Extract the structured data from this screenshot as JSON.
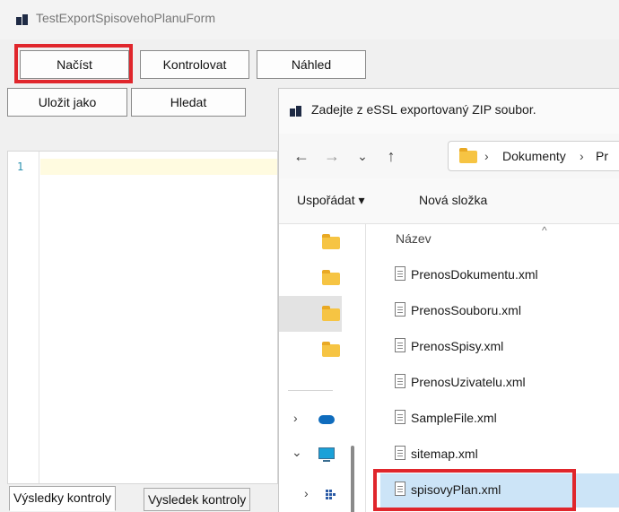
{
  "app": {
    "title": "TestExportSpisovehoPlanuForm"
  },
  "toolbar": {
    "load_label": "Načíst",
    "check_label": "Kontrolovat",
    "preview_label": "Náhled",
    "save_as_label": "Uložit jako",
    "search_label": "Hledat"
  },
  "editor": {
    "line_numbers": [
      "1"
    ]
  },
  "tabs": [
    "Výsledky kontroly",
    "Vysledek kontroly"
  ],
  "dialog": {
    "title": "Zadejte z eSSL exportovaný ZIP soubor.",
    "nav": {
      "back": "←",
      "forward": "→",
      "recent": "⌄",
      "up": "↑"
    },
    "breadcrumb": {
      "sep": "›",
      "part1": "Dokumenty",
      "part2": "Pr"
    },
    "commands": {
      "organize": "Uspořádat ▾",
      "new_folder": "Nová složka"
    },
    "column_header": "Název",
    "files": [
      "PrenosDokumentu.xml",
      "PrenosSouboru.xml",
      "PrenosSpisy.xml",
      "PrenosUzivatelu.xml",
      "SampleFile.xml",
      "sitemap.xml",
      "spisovyPlan.xml"
    ],
    "selected_file": "spisovyPlan.xml"
  },
  "colors": {
    "highlight": "#e0262c",
    "selection": "#cce4f7",
    "folder": "#f6c443"
  }
}
